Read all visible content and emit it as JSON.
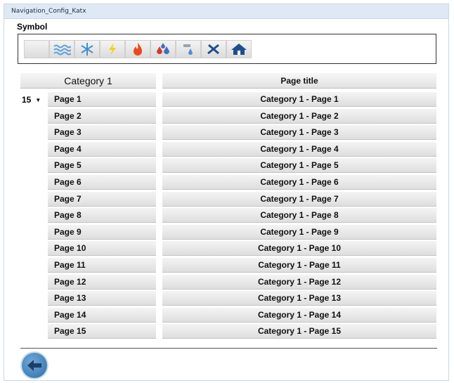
{
  "window": {
    "title": "Navigation_Config_Katx"
  },
  "symbol": {
    "label": "Symbol",
    "icons": [
      "blank-icon",
      "waves-icon",
      "snowflake-icon",
      "lightning-icon",
      "flame-icon",
      "droplets-icon",
      "water-tap-icon",
      "tools-icon",
      "house-icon"
    ]
  },
  "table": {
    "category_header": "Category 1",
    "title_header": "Page title",
    "count_select": {
      "value": "15"
    },
    "rows": [
      {
        "page": "Page 1",
        "title": "Category 1 - Page 1"
      },
      {
        "page": "Page 2",
        "title": "Category 1 - Page 2"
      },
      {
        "page": "Page 3",
        "title": "Category 1 - Page 3"
      },
      {
        "page": "Page 4",
        "title": "Category 1 - Page 4"
      },
      {
        "page": "Page 5",
        "title": "Category 1 - Page 5"
      },
      {
        "page": "Page 6",
        "title": "Category 1 - Page 6"
      },
      {
        "page": "Page 7",
        "title": "Category 1 - Page 7"
      },
      {
        "page": "Page 8",
        "title": "Category 1 - Page 8"
      },
      {
        "page": "Page 9",
        "title": "Category 1 - Page 9"
      },
      {
        "page": "Page 10",
        "title": "Category 1 - Page 10"
      },
      {
        "page": "Page 11",
        "title": "Category 1 - Page 11"
      },
      {
        "page": "Page 12",
        "title": "Category 1 - Page 12"
      },
      {
        "page": "Page 13",
        "title": "Category 1 - Page 13"
      },
      {
        "page": "Page 14",
        "title": "Category 1 - Page 14"
      },
      {
        "page": "Page 15",
        "title": "Category 1 - Page 15"
      }
    ]
  },
  "footer": {
    "back_icon": "back-arrow-icon",
    "accent": "#2d6ea8"
  }
}
